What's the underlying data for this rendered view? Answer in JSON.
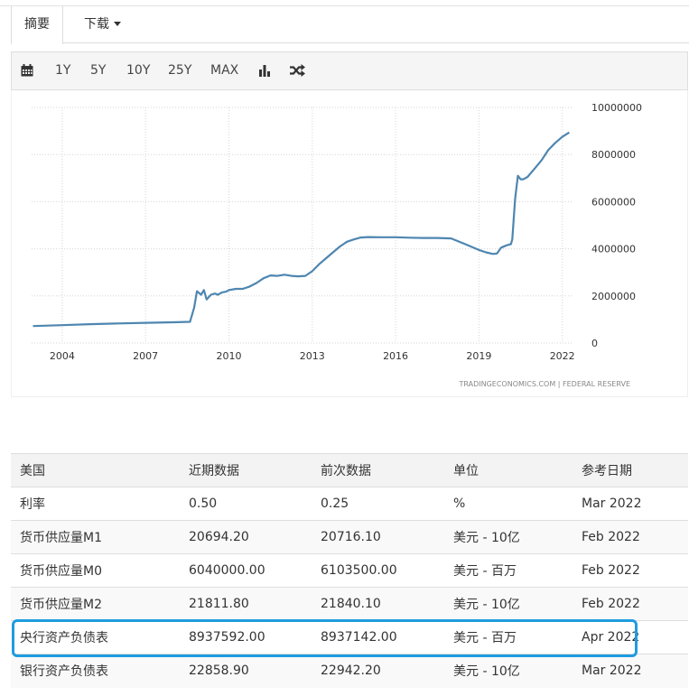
{
  "tabs": {
    "summary": "摘要",
    "download": "下载"
  },
  "toolbar": {
    "ranges": [
      "1Y",
      "5Y",
      "10Y",
      "25Y",
      "MAX"
    ],
    "icons": [
      "calendar-icon",
      "bar-chart-icon",
      "shuffle-icon"
    ]
  },
  "chart_data": {
    "type": "line",
    "title": "",
    "xlabel": "",
    "ylabel": "",
    "x_ticks": [
      "2004",
      "2007",
      "2010",
      "2013",
      "2016",
      "2019",
      "2022"
    ],
    "y_ticks": [
      "0",
      "2000000",
      "4000000",
      "6000000",
      "8000000",
      "10000000"
    ],
    "xlim": [
      2002.9,
      2022.4
    ],
    "ylim": [
      0,
      10000000
    ],
    "grid": true,
    "color": "#4e86b0",
    "source": "TRADINGECONOMICS.COM | FEDERAL RESERVE",
    "x": [
      2002.95,
      2004.0,
      2005.0,
      2006.0,
      2007.0,
      2008.0,
      2008.6,
      2008.75,
      2008.85,
      2009.0,
      2009.1,
      2009.2,
      2009.35,
      2009.5,
      2009.6,
      2009.75,
      2009.9,
      2010.0,
      2010.25,
      2010.5,
      2010.75,
      2011.0,
      2011.25,
      2011.5,
      2011.75,
      2012.0,
      2012.25,
      2012.5,
      2012.75,
      2013.0,
      2013.25,
      2013.5,
      2013.75,
      2014.0,
      2014.25,
      2014.5,
      2014.75,
      2015.0,
      2015.5,
      2016.0,
      2016.5,
      2017.0,
      2017.5,
      2018.0,
      2018.5,
      2019.0,
      2019.25,
      2019.5,
      2019.65,
      2019.8,
      2020.0,
      2020.15,
      2020.2,
      2020.3,
      2020.4,
      2020.5,
      2020.6,
      2020.75,
      2021.0,
      2021.25,
      2021.5,
      2021.75,
      2022.0,
      2022.25
    ],
    "y": [
      720000,
      760000,
      800000,
      830000,
      860000,
      880000,
      900000,
      1500000,
      2200000,
      2050000,
      2250000,
      1850000,
      2050000,
      2100000,
      2050000,
      2150000,
      2180000,
      2250000,
      2300000,
      2300000,
      2400000,
      2550000,
      2750000,
      2870000,
      2850000,
      2900000,
      2850000,
      2830000,
      2850000,
      3050000,
      3350000,
      3600000,
      3850000,
      4100000,
      4300000,
      4400000,
      4480000,
      4500000,
      4490000,
      4490000,
      4470000,
      4460000,
      4460000,
      4440000,
      4200000,
      3950000,
      3850000,
      3780000,
      3800000,
      4050000,
      4150000,
      4200000,
      4400000,
      6100000,
      7100000,
      6950000,
      6950000,
      7050000,
      7400000,
      7750000,
      8200000,
      8500000,
      8750000,
      8940000
    ]
  },
  "table": {
    "headers": [
      "美国",
      "近期数据",
      "前次数据",
      "单位",
      "参考日期"
    ],
    "rows": [
      [
        "利率",
        "0.50",
        "0.25",
        "%",
        "Mar 2022"
      ],
      [
        "货币供应量M1",
        "20694.20",
        "20716.10",
        "美元 - 10亿",
        "Feb 2022"
      ],
      [
        "货币供应量M0",
        "6040000.00",
        "6103500.00",
        "美元 - 百万",
        "Feb 2022"
      ],
      [
        "货币供应量M2",
        "21811.80",
        "21840.10",
        "美元 - 10亿",
        "Feb 2022"
      ],
      [
        "央行资产负债表",
        "8937592.00",
        "8937142.00",
        "美元 - 百万",
        "Apr 2022"
      ],
      [
        "银行资产负债表",
        "22858.90",
        "22942.20",
        "美元 - 10亿",
        "Mar 2022"
      ]
    ],
    "highlight_row": 4,
    "highlight_color": "#1f9ce0"
  }
}
